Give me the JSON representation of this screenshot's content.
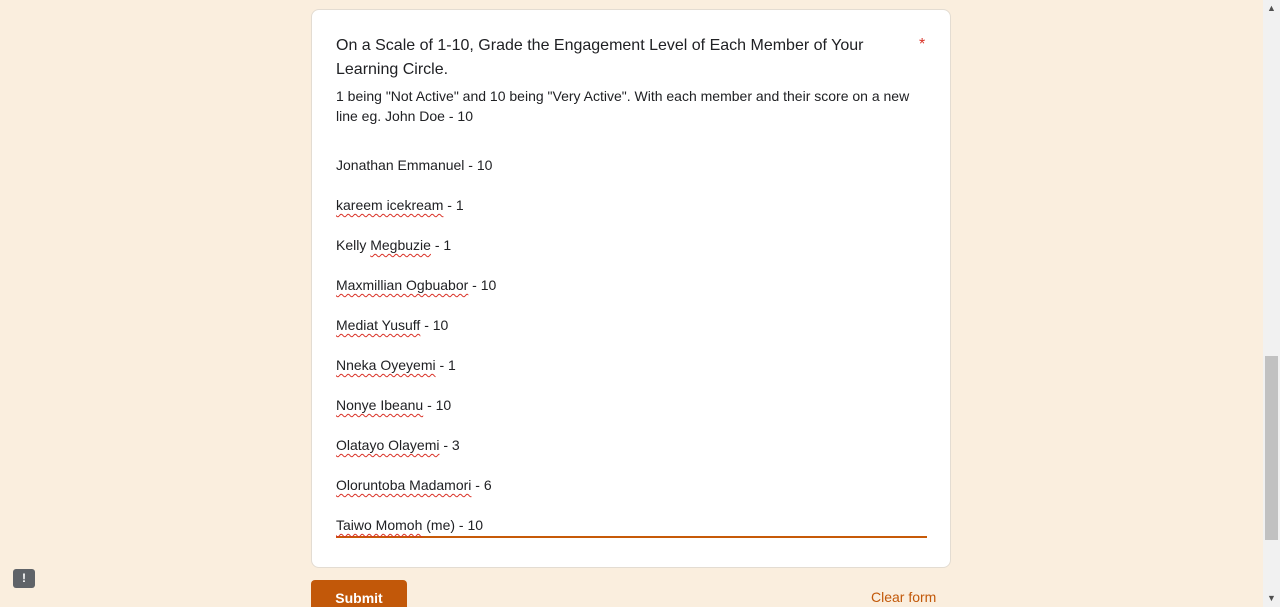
{
  "question": {
    "title": "On a Scale of 1-10, Grade the Engagement Level of Each Member of Your Learning Circle.",
    "required_marker": "*",
    "description": "1 being \"Not Active\" and 10 being \"Very Active\". With each member and their score on a new line eg. John Doe - 10"
  },
  "answer": {
    "lines": [
      {
        "name": "Jonathan Emmanuel",
        "score": " - 10"
      },
      {
        "name": "kareem icekream",
        "score": " - 1"
      },
      {
        "name": "Kelly Megbuzie",
        "score": " - 1"
      },
      {
        "name": "Maxmillian Ogbuabor",
        "score": " - 10"
      },
      {
        "name": "Mediat Yusuff",
        "score": " - 10"
      },
      {
        "name": "Nneka Oyeyemi",
        "score": " - 1"
      },
      {
        "name": "Nonye Ibeanu",
        "score": " - 10"
      },
      {
        "name": "Olatayo Olayemi",
        "score": " - 3"
      },
      {
        "name": "Oloruntoba Madamori",
        "score": " - 6"
      },
      {
        "name": "Taiwo Momoh",
        "score": " (me) - 10"
      }
    ]
  },
  "actions": {
    "submit_label": "Submit",
    "clear_label": "Clear form"
  },
  "feedback": {
    "icon": "report-problem-icon",
    "glyph": "!"
  },
  "scrollbar": {
    "up_glyph": "▲",
    "down_glyph": "▼"
  },
  "colors": {
    "background": "#faeede",
    "accent": "#c25809",
    "required": "#d93025"
  }
}
